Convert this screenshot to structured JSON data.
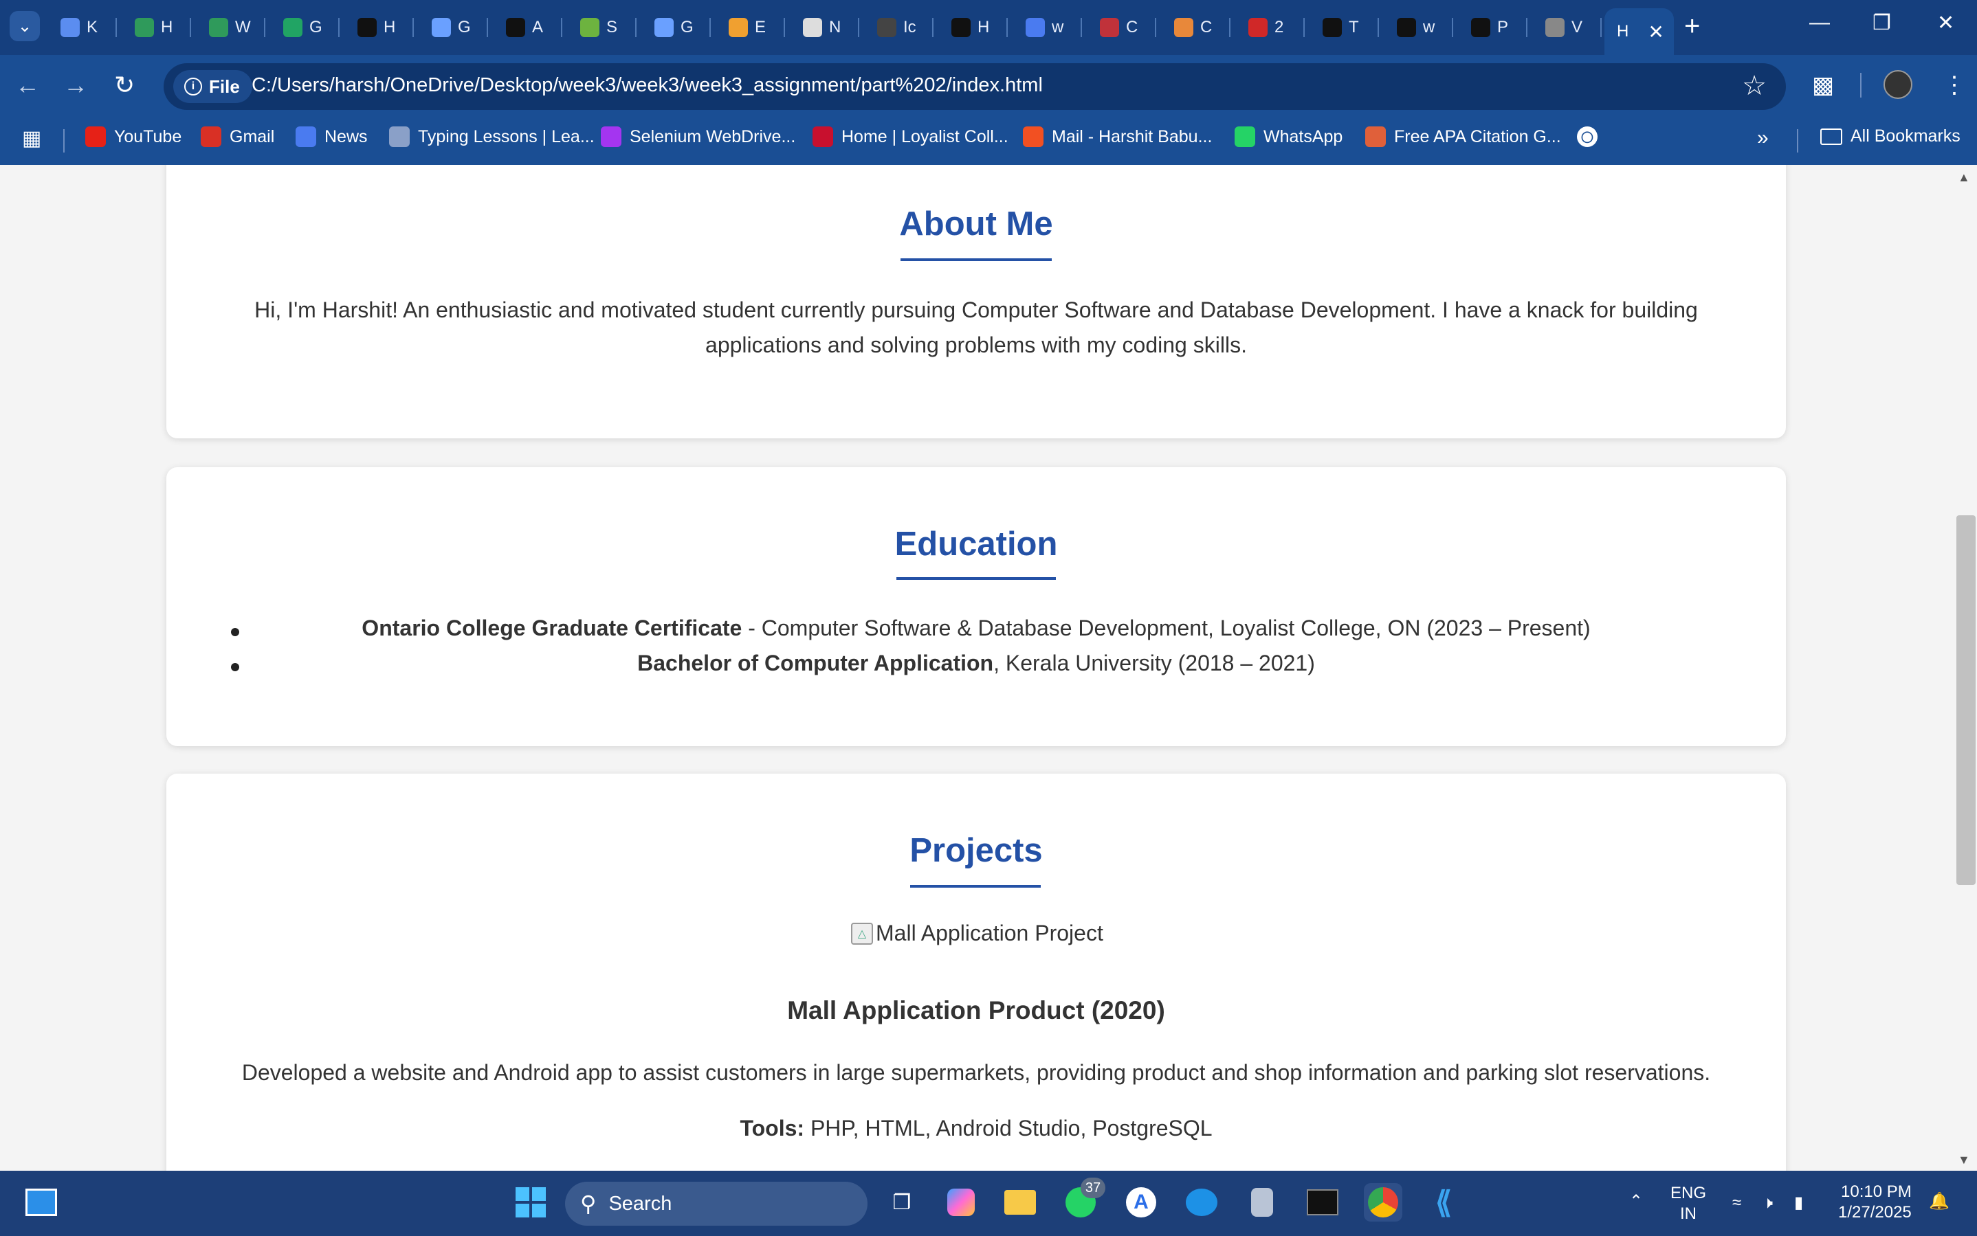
{
  "browser": {
    "tabs": [
      {
        "letter": "K",
        "icon": "app-icon",
        "color": "#5b8df0"
      },
      {
        "letter": "H",
        "icon": "w-logo-icon",
        "color": "#2f9a5b"
      },
      {
        "letter": "W",
        "icon": "w-logo-icon",
        "color": "#2f9a5b"
      },
      {
        "letter": "G",
        "icon": "sheets-icon",
        "color": "#21a464"
      },
      {
        "letter": "H",
        "icon": "openai-icon",
        "color": "#111111"
      },
      {
        "letter": "G",
        "icon": "gemini-icon",
        "color": "#6aa0ff"
      },
      {
        "letter": "A",
        "icon": "openai-icon",
        "color": "#111111"
      },
      {
        "letter": "S",
        "icon": "spring-icon",
        "color": "#6db33f"
      },
      {
        "letter": "G",
        "icon": "gemini-icon",
        "color": "#6aa0ff"
      },
      {
        "letter": "E",
        "icon": "ef-icon",
        "color": "#f0a030"
      },
      {
        "letter": "N",
        "icon": "chrome-icon",
        "color": "#dddddd"
      },
      {
        "letter": "Ic",
        "icon": "react-icon",
        "color": "#444444"
      },
      {
        "letter": "H",
        "icon": "openai-icon",
        "color": "#111111"
      },
      {
        "letter": "w",
        "icon": "docs-icon",
        "color": "#4a7bf0"
      },
      {
        "letter": "C",
        "icon": "app-icon",
        "color": "#c0323a"
      },
      {
        "letter": "C",
        "icon": "image-icon",
        "color": "#e8883a"
      },
      {
        "letter": "2",
        "icon": "app-icon",
        "color": "#d02828"
      },
      {
        "letter": "T",
        "icon": "openai-icon",
        "color": "#111111"
      },
      {
        "letter": "w",
        "icon": "github-icon",
        "color": "#111111"
      },
      {
        "letter": "P",
        "icon": "openai-icon",
        "color": "#111111"
      },
      {
        "letter": "V",
        "icon": "globe-icon",
        "color": "#888888"
      }
    ],
    "active_tab_letter": "H",
    "omnibox": {
      "chip_label": "File",
      "url": "C:/Users/harsh/OneDrive/Desktop/week3/week3/week3_assignment/part%202/index.html"
    },
    "bookmarks": [
      {
        "label": "YouTube",
        "icon": "youtube-icon",
        "color": "#e62117"
      },
      {
        "label": "Gmail",
        "icon": "gmail-icon",
        "color": "#d93025"
      },
      {
        "label": "News",
        "icon": "news-icon",
        "color": "#4a7bf0"
      },
      {
        "label": "Typing Lessons | Lea...",
        "icon": "typing-icon",
        "color": "#8aa0c8"
      },
      {
        "label": "Selenium WebDrive...",
        "icon": "udemy-icon",
        "color": "#a435f0"
      },
      {
        "label": "Home | Loyalist Coll...",
        "icon": "loyalist-icon",
        "color": "#c8102e"
      },
      {
        "label": "Mail - Harshit Babu...",
        "icon": "microsoft-icon",
        "color": "#f25022"
      },
      {
        "label": "WhatsApp",
        "icon": "whatsapp-icon",
        "color": "#25d366"
      },
      {
        "label": "Free APA Citation G...",
        "icon": "citation-icon",
        "color": "#e0603a"
      }
    ],
    "all_bookmarks_label": "All Bookmarks"
  },
  "page": {
    "about": {
      "title": "About Me",
      "body": "Hi, I'm Harshit! An enthusiastic and motivated student currently pursuing Computer Software and Database Development. I have a knack for building applications and solving problems with my coding skills."
    },
    "education": {
      "title": "Education",
      "items": [
        {
          "bold": "Ontario College Graduate Certificate",
          "rest": " - Computer Software & Database Development, Loyalist College, ON (2023 – Present)"
        },
        {
          "bold": "Bachelor of Computer Application",
          "rest": ", Kerala University (2018 – 2021)"
        }
      ]
    },
    "projects": {
      "title": "Projects",
      "image_alt": "Mall Application Project",
      "project_name": "Mall Application Product (2020)",
      "description": "Developed a website and Android app to assist customers in large supermarkets, providing product and shop information and parking slot reservations.",
      "tools_label": "Tools:",
      "tools_value": " PHP, HTML, Android Studio, PostgreSQL"
    }
  },
  "taskbar": {
    "search_label": "Search",
    "whatsapp_badge": "37",
    "lang_line1": "ENG",
    "lang_line2": "IN",
    "time": "10:10 PM",
    "date": "1/27/2025"
  }
}
